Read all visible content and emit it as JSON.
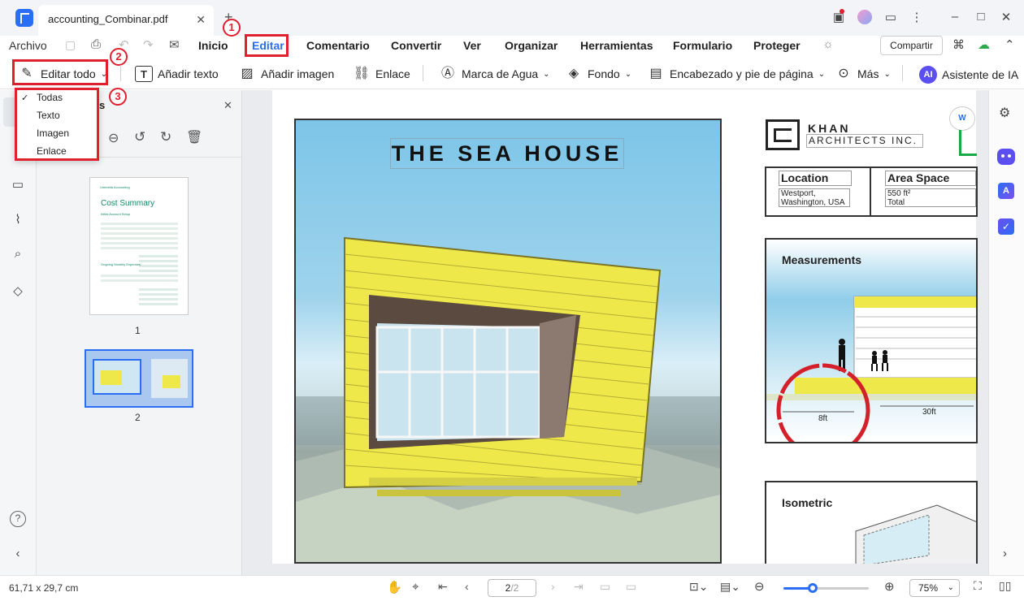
{
  "tab": {
    "title": "accounting_Combinar.pdf",
    "close": "✕",
    "new": "+"
  },
  "menu": {
    "file": "Archivo",
    "items": [
      "Inicio",
      "Editar",
      "Comentario",
      "Convertir",
      "Ver",
      "Organizar",
      "Herramientas",
      "Formulario",
      "Proteger"
    ],
    "share": "Compartir"
  },
  "toolbar": {
    "edit_all": "Editar todo",
    "add_text": "Añadir texto",
    "add_image": "Añadir imagen",
    "link": "Enlace",
    "watermark": "Marca de Agua",
    "background": "Fondo",
    "header_footer": "Encabezado y pie de página",
    "more": "Más",
    "ai": "Asistente de IA",
    "ai_badge": "AI"
  },
  "dropdown": {
    "items": [
      "Todas",
      "Texto",
      "Imagen",
      "Enlace"
    ],
    "checked": "✓"
  },
  "markers": {
    "one": "1",
    "two": "2",
    "three": "3"
  },
  "panel": {
    "title_fragment": "s",
    "close": "✕",
    "pages": [
      "1",
      "2"
    ]
  },
  "thumb1": {
    "brand": "Umbrella Accounting",
    "title": "Cost Summary",
    "section1": "Initial Account Setup",
    "section2": "Ongoing Monthly Expenses"
  },
  "doc": {
    "title": "THE SEA HOUSE",
    "firm1": "KHAN",
    "firm2": "ARCHITECTS INC.",
    "location_label": "Location",
    "location_value1": "Westport,",
    "location_value2": "Washington, USA",
    "area_label": "Area Space",
    "area_value1": "550 ft²",
    "area_value2": "Total",
    "measurements": "Measurements",
    "dim1": "8ft",
    "dim2": "30ft",
    "isometric": "Isometric"
  },
  "status": {
    "dimensions": "61,71 x 29,7 cm",
    "page_current": "2",
    "page_total": "/2",
    "zoom": "75%"
  },
  "colors": {
    "accent": "#2a6ef5",
    "highlight": "#e0202e",
    "house_yellow": "#efe84a",
    "sky": "#7dc5e8"
  }
}
